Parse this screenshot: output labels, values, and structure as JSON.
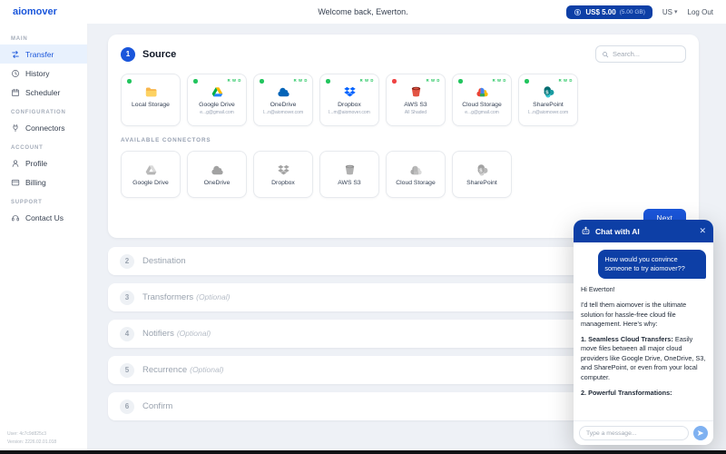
{
  "colors": {
    "accent": "#1a56db",
    "navy": "#0d3fa6",
    "success": "#22c55e",
    "danger": "#ef4444"
  },
  "topbar": {
    "logo": "aiomover",
    "welcome": "Welcome back, Ewerton.",
    "balance": "US$ 5.00",
    "balance_sub": "(5.00 GB)",
    "locale": "US",
    "chevron": "▾",
    "logout": "Log Out"
  },
  "sidebar": {
    "sections": [
      {
        "label": "MAIN",
        "items": [
          {
            "label": "Transfer"
          },
          {
            "label": "History"
          },
          {
            "label": "Scheduler"
          }
        ]
      },
      {
        "label": "CONFIGURATION",
        "items": [
          {
            "label": "Connectors"
          }
        ]
      },
      {
        "label": "ACCOUNT",
        "items": [
          {
            "label": "Profile"
          },
          {
            "label": "Billing"
          }
        ]
      },
      {
        "label": "SUPPORT",
        "items": [
          {
            "label": "Contact Us"
          }
        ]
      }
    ],
    "user": "User: 4c7c9d825c3",
    "version": "Version: 2226.02.01.018"
  },
  "source": {
    "step_number": "1",
    "title": "Source",
    "search_placeholder": "Search...",
    "connected": [
      {
        "name": "Local Storage",
        "subtitle": "",
        "perms": ""
      },
      {
        "name": "Google Drive",
        "subtitle": "e...g@gmail.com",
        "perms": "R W D"
      },
      {
        "name": "OneDrive",
        "subtitle": "l...n@aiomover.com",
        "perms": "R W D"
      },
      {
        "name": "Dropbox",
        "subtitle": "l...m@aiomover.com",
        "perms": "R W D"
      },
      {
        "name": "AWS S3",
        "subtitle": "All Shaded",
        "perms": "R W D"
      },
      {
        "name": "Cloud Storage",
        "subtitle": "e...g@gmail.com",
        "perms": "R W D"
      },
      {
        "name": "SharePoint",
        "subtitle": "l...n@aiomover.com",
        "perms": "R W D"
      }
    ],
    "available_label": "AVAILABLE CONNECTORS",
    "available": [
      "Google Drive",
      "OneDrive",
      "Dropbox",
      "AWS S3",
      "Cloud Storage",
      "SharePoint"
    ],
    "next_label": "Next"
  },
  "steps": [
    {
      "number": "2",
      "label": "Destination",
      "optional": ""
    },
    {
      "number": "3",
      "label": "Transformers",
      "optional": "(Optional)"
    },
    {
      "number": "4",
      "label": "Notifiers",
      "optional": "(Optional)"
    },
    {
      "number": "5",
      "label": "Recurrence",
      "optional": "(Optional)"
    },
    {
      "number": "6",
      "label": "Confirm",
      "optional": ""
    }
  ],
  "chat": {
    "title": "Chat with AI",
    "close_glyph": "✕",
    "user_message": "How would you convince someone to try aiomover??",
    "ai": {
      "greeting": "Hi Ewerton!",
      "intro": "I'd tell them aiomover is the ultimate solution for hassle-free cloud file management. Here's why:",
      "point1_title": "1. Seamless Cloud Transfers:",
      "point1_text": "Easily move files between all major cloud providers like Google Drive, OneDrive, S3, and SharePoint, or even from your local computer.",
      "point2_title": "2. Powerful Transformations:"
    },
    "input_placeholder": "Type a message..."
  }
}
